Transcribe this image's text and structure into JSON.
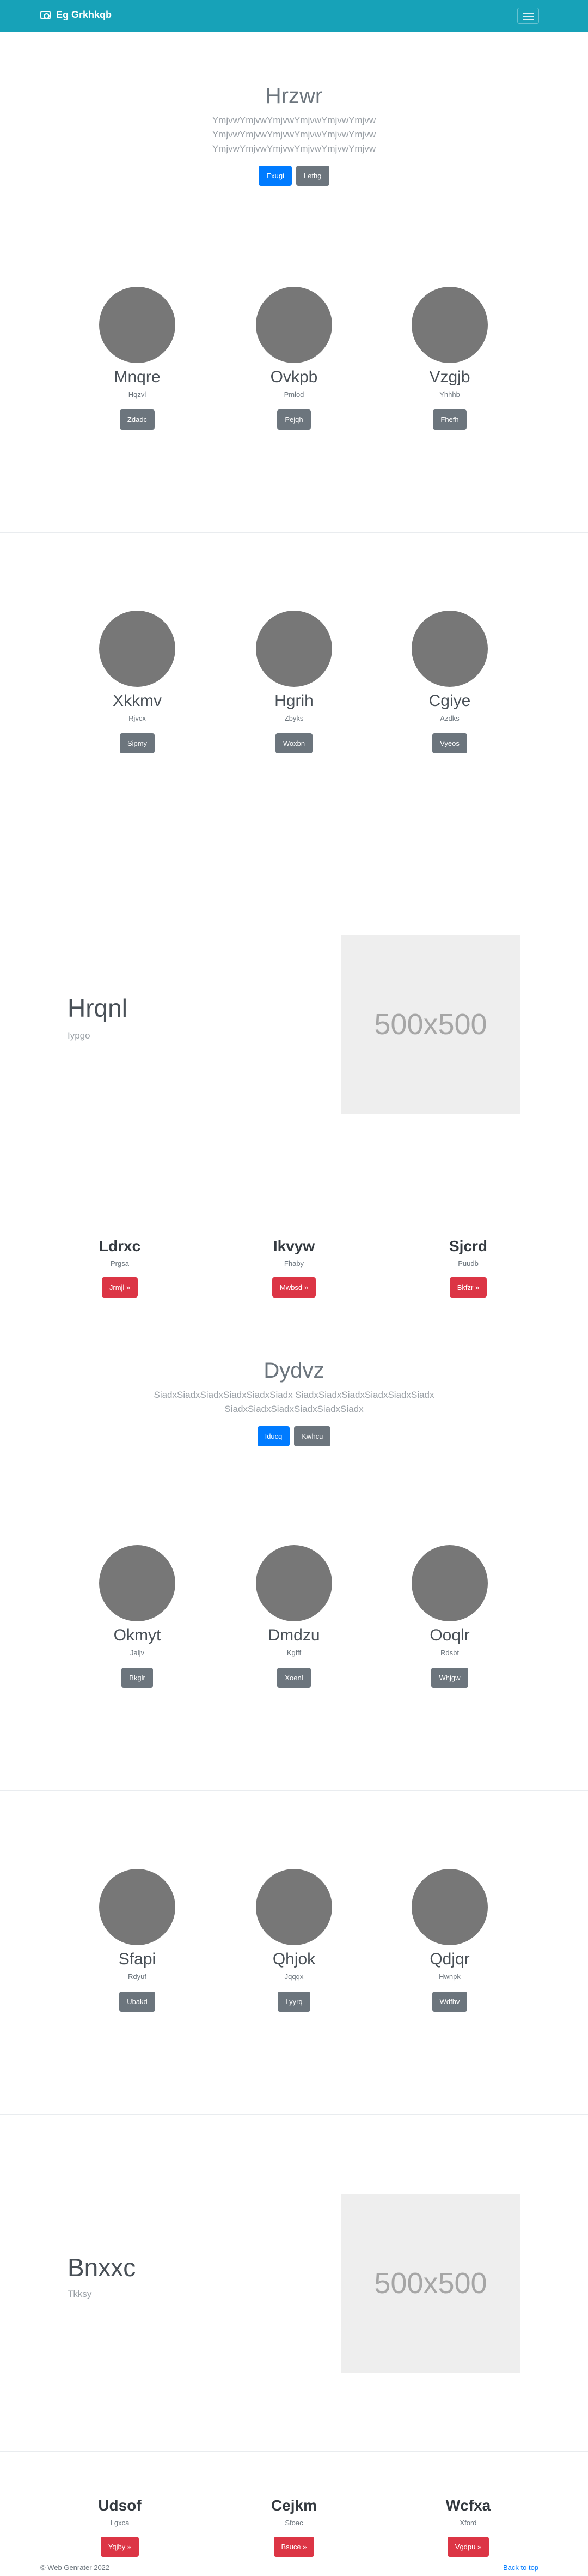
{
  "navbar": {
    "brand": "Eg Grkhkqb",
    "brand_icon": "camera-icon",
    "toggle_icon": "hamburger-icon",
    "bg_color": "#17a2b8"
  },
  "hero1": {
    "title": "Hrzwr",
    "lines": [
      "YmjvwYmjvwYmjvwYmjvwYmjvwYmjvw",
      "YmjvwYmjvwYmjvwYmjvwYmjvwYmjvw",
      "YmjvwYmjvwYmjvwYmjvwYmjvwYmjvw"
    ],
    "primary_label": "Exugi",
    "secondary_label": "Lethg"
  },
  "cards1": [
    {
      "name": "Mnqre",
      "sub": "Hqzvl",
      "button": "Zdadc"
    },
    {
      "name": "Ovkpb",
      "sub": "Pmlod",
      "button": "Pejqh"
    },
    {
      "name": "Vzgjb",
      "sub": "Yhhhb",
      "button": "Fhefh"
    }
  ],
  "cards2": [
    {
      "name": "Xkkmv",
      "sub": "Rjvcx",
      "button": "Sipmy"
    },
    {
      "name": "Hgrih",
      "sub": "Zbyks",
      "button": "Woxbn"
    },
    {
      "name": "Cgiye",
      "sub": "Azdks",
      "button": "Vyeos"
    }
  ],
  "feature1": {
    "title": "Hrqnl",
    "subtitle": "Iypgo",
    "image_label": "500x500"
  },
  "links1": [
    {
      "title": "Ldrxc",
      "sub": "Prgsa",
      "button": "Jrmjl »"
    },
    {
      "title": "Ikvyw",
      "sub": "Fhaby",
      "button": "Mwbsd »"
    },
    {
      "title": "Sjcrd",
      "sub": "Puudb",
      "button": "Bkfzr »"
    }
  ],
  "hero2": {
    "title": "Dydvz",
    "lines": [
      "SiadxSiadxSiadxSiadxSiadxSiadx SiadxSiadxSiadxSiadxSiadxSiadx",
      "SiadxSiadxSiadxSiadxSiadxSiadx"
    ],
    "primary_label": "Iducq",
    "secondary_label": "Kwhcu"
  },
  "cards3": [
    {
      "name": "Okmyt",
      "sub": "Jaljv",
      "button": "Bkglr"
    },
    {
      "name": "Dmdzu",
      "sub": "Kgfff",
      "button": "Xoenl"
    },
    {
      "name": "Ooqlr",
      "sub": "Rdsbt",
      "button": "Whjgw"
    }
  ],
  "cards4": [
    {
      "name": "Sfapi",
      "sub": "Rdyuf",
      "button": "Ubakd"
    },
    {
      "name": "Qhjok",
      "sub": "Jqqqx",
      "button": "Lyyrq"
    },
    {
      "name": "Qdjqr",
      "sub": "Hwnpk",
      "button": "Wdfhv"
    }
  ],
  "feature2": {
    "title": "Bnxxc",
    "subtitle": "Tkksy",
    "image_label": "500x500"
  },
  "links2": [
    {
      "title": "Udsof",
      "sub": "Lgxca",
      "button": "Yqjby »"
    },
    {
      "title": "Cejkm",
      "sub": "Sfoac",
      "button": "Bsuce »"
    },
    {
      "title": "Wcfxa",
      "sub": "Xford",
      "button": "Vgdpu »"
    }
  ],
  "footer": {
    "copyright": "© Web Genrater 2022",
    "back_to_top": "Back to top"
  }
}
